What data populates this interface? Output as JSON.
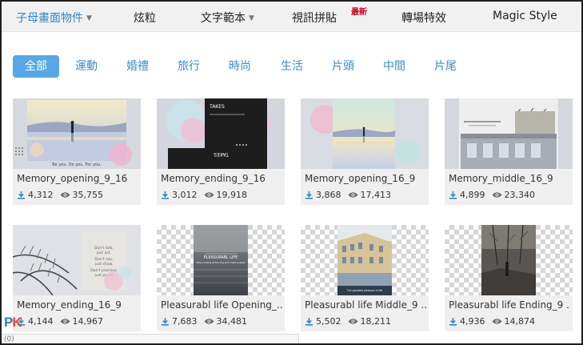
{
  "nav": {
    "items": [
      {
        "label": "子母畫面物件",
        "has_caret": true,
        "active": true
      },
      {
        "label": "炫粒",
        "has_caret": false,
        "active": false
      },
      {
        "label": "文字範本",
        "has_caret": true,
        "active": false
      },
      {
        "label": "視訊拼貼",
        "has_caret": false,
        "active": false
      },
      {
        "label": "轉場特效",
        "has_caret": false,
        "active": false
      },
      {
        "label": "Magic Style",
        "has_caret": false,
        "active": false
      }
    ],
    "new_badge": "最新"
  },
  "tabs": [
    "全部",
    "運動",
    "婚禮",
    "旅行",
    "時尚",
    "生活",
    "片頭",
    "中間",
    "片尾"
  ],
  "thumb_text": {
    "takes_top": "TAKES",
    "takes_bottom": "TAKES",
    "beyou": "Be you. Do you. For you.",
    "mountain_caption": "Stop looking at the fog and make a gaze",
    "palm_lines": [
      "Don't talk,",
      "just act.",
      "Don't say,",
      "just show.",
      "Don't promise,",
      "just prove"
    ],
    "pleasurable": "PLEASURABL LIFE",
    "greatest": "The greatest pleasure in life"
  },
  "cards": [
    {
      "title": "Memory_opening_9_16",
      "downloads": "4,312",
      "views": "35,755"
    },
    {
      "title": "Memory_ending_9_16",
      "downloads": "3,012",
      "views": "19,918"
    },
    {
      "title": "Memory_opening_16_9",
      "downloads": "3,868",
      "views": "17,413"
    },
    {
      "title": "Memory_middle_16_9",
      "downloads": "4,899",
      "views": "23,340"
    },
    {
      "title": "Memory_ending_16_9",
      "downloads": "4,144",
      "views": "14,967"
    },
    {
      "title": "Pleasurabl life Opening_...",
      "downloads": "7,683",
      "views": "34,481"
    },
    {
      "title": "Pleasurabl life Middle_9 ...",
      "downloads": "5,502",
      "views": "18,211"
    },
    {
      "title": "Pleasurabl life Ending_9 ...",
      "downloads": "4,936",
      "views": "14,874"
    }
  ],
  "status_bar": "(0)",
  "logo": {
    "p": "P",
    "k": "K"
  },
  "colors": {
    "accent": "#57a8e4",
    "tab_text": "#3a8ccc",
    "nav_active": "#2f86c9",
    "badge": "#d0021b",
    "icon": "#2f86c9"
  }
}
